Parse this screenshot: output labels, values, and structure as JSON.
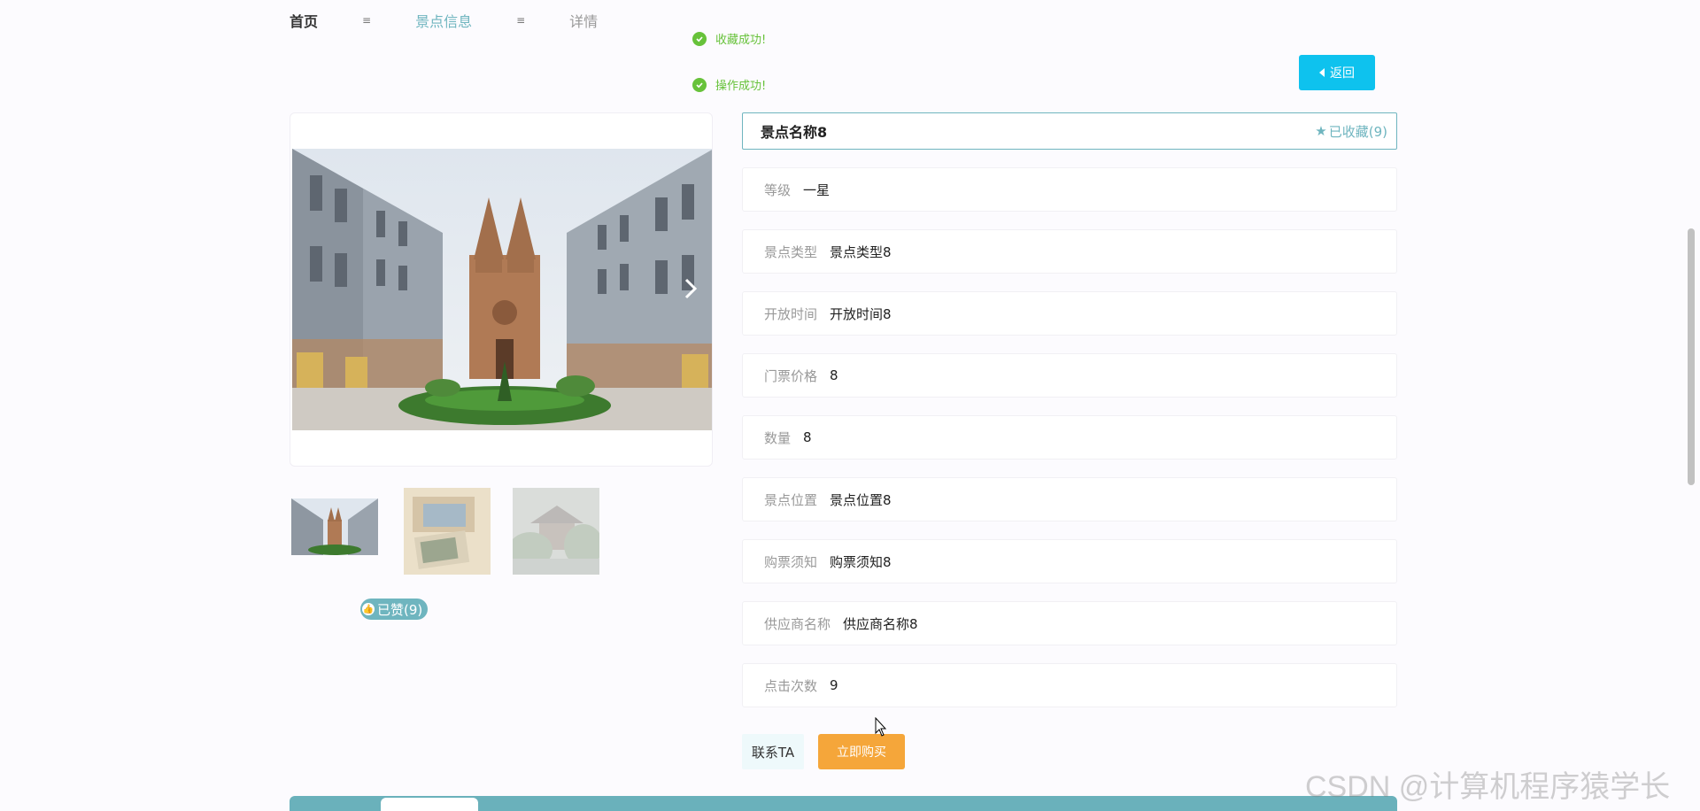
{
  "breadcrumb": {
    "home": "首页",
    "separator_1": "≡",
    "middle": "景点信息",
    "separator_2": "≡",
    "current": "详情"
  },
  "toasts": [
    {
      "text": "收藏成功!",
      "icon": "check-circle-icon"
    },
    {
      "text": "操作成功!",
      "icon": "check-circle-icon"
    }
  ],
  "back_button": {
    "label": "返回",
    "icon": "caret-left-icon"
  },
  "carousel": {
    "next_icon": "chevron-right-icon"
  },
  "like": {
    "label": "已赞(9)",
    "icon": "thumb-up-icon"
  },
  "detail": {
    "title": "景点名称8",
    "favorite_label": "已收藏(9)",
    "favorite_icon": "star-icon",
    "rows": [
      {
        "label": "等级",
        "value": "一星"
      },
      {
        "label": "景点类型",
        "value": "景点类型8"
      },
      {
        "label": "开放时间",
        "value": "开放时间8"
      },
      {
        "label": "门票价格",
        "value": "8"
      },
      {
        "label": "数量",
        "value": "8"
      },
      {
        "label": "景点位置",
        "value": "景点位置8"
      },
      {
        "label": "购票须知",
        "value": "购票须知8"
      },
      {
        "label": "供应商名称",
        "value": "供应商名称8"
      },
      {
        "label": "点击次数",
        "value": "9"
      }
    ]
  },
  "actions": {
    "contact": "联系TA",
    "buy": "立即购买"
  },
  "watermark": "CSDN @计算机程序猿学长",
  "colors": {
    "accent": "#6fb5bf",
    "back_button": "#0ec2ee",
    "buy_button": "#f5a63a",
    "success": "#67c23a"
  }
}
